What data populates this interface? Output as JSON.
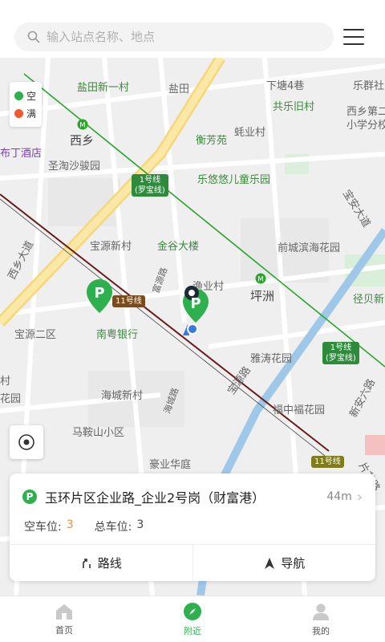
{
  "search": {
    "placeholder": "输入站点名称、地点"
  },
  "legend": [
    {
      "label": "空",
      "color": "#2eb04f"
    },
    {
      "label": "满",
      "color": "#f05a2e"
    }
  ],
  "map": {
    "labels": {
      "yantian_xinyicun": "盐田新一村",
      "yantian": "盐田",
      "xiatang4xiang": "下塘4巷",
      "leqiongcun": "乐群社",
      "xixiang": "西乡",
      "gongle_jiucun": "共乐旧村",
      "xixiang_school": "西乡第二",
      "xixiang_school2": "小学分校",
      "shengtao": "圣淘沙骏园",
      "hengfangyuan": "衡芳苑",
      "zhiyecun": "蚝业村",
      "hotel": "布丁酒店",
      "leyouyou": "乐悠悠儿童乐园",
      "baoan_dadao": "宝安大道",
      "baoyuan_xincun": "宝源新村",
      "jingu_dalou": "金谷大楼",
      "qiancheng": "前城滨海花园",
      "xixiang_dadao": "西乡大道",
      "yuyecun": "渔业村",
      "pingzhou": "坪洲",
      "jingbei": "径贝新",
      "baoyuan_erqu": "宝源二区",
      "nanyue_bank": "南粤银行",
      "yatao": "雅涛花园",
      "cun": "村",
      "huayuan": "花园",
      "haicheng": "海城新村",
      "fuzhong": "福中福花园",
      "maanshan": "马鞍山小区",
      "haocheng": "豪业华庭",
      "baoyuan_road": "宝源路",
      "xinan_liuwu": "新安六路",
      "pianzhu": "片芯路",
      "shangpu": "海城路",
      "ruifeng": "富源路"
    },
    "badges": {
      "line1_a": "1号线",
      "line1_a2": "(罗宝线)",
      "line1_b": "1号线",
      "line1_b2": "(罗宝线)",
      "line11_a": "11号线",
      "line11_b": "11号线"
    }
  },
  "station": {
    "badge": "P",
    "name": "玉环片区企业路_企业2号岗（财富港）",
    "distance": "44m",
    "empty_label": "空车位:",
    "empty_value": "3",
    "total_label": "总车位:",
    "total_value": "3",
    "route_label": "路线",
    "nav_label": "导航"
  },
  "tabs": [
    {
      "label": "首页",
      "active": false
    },
    {
      "label": "附近",
      "active": true
    },
    {
      "label": "我的",
      "active": false
    }
  ],
  "colors": {
    "accent": "#2eb04f",
    "full": "#f05a2e",
    "orange_value": "#f0912f"
  }
}
